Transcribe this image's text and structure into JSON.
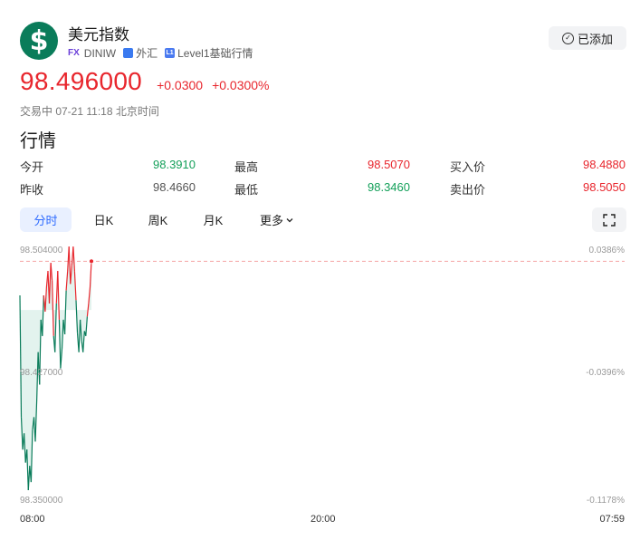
{
  "header": {
    "logo_symbol": "$",
    "title": "美元指数",
    "exchange_badge": "FX",
    "code": "DINIW",
    "category_icon": "chart-square-icon",
    "category": "外汇",
    "level_badge": "L1",
    "level_text": "Level1基础行情",
    "added_button": "已添加"
  },
  "price": {
    "last": "98.496000",
    "change": "+0.0300",
    "change_pct": "+0.0300%",
    "status": "交易中 07-21 11:18 北京时间"
  },
  "section_title": "行情",
  "quotes": [
    {
      "label": "今开",
      "value": "98.3910",
      "color": "green"
    },
    {
      "label": "最高",
      "value": "98.5070",
      "color": "red"
    },
    {
      "label": "买入价",
      "value": "98.4880",
      "color": "red"
    },
    {
      "label": "昨收",
      "value": "98.4660",
      "color": "gray"
    },
    {
      "label": "最低",
      "value": "98.3460",
      "color": "green"
    },
    {
      "label": "卖出价",
      "value": "98.5050",
      "color": "red"
    }
  ],
  "tabs": [
    "分时",
    "日K",
    "周K",
    "月K",
    "更多"
  ],
  "active_tab": "分时",
  "chart_axis": {
    "left_top": "98.504000",
    "left_mid": "98.427000",
    "left_bottom": "98.350000",
    "right_top": "0.0386%",
    "right_mid": "-0.0396%",
    "right_bottom": "-0.1178%",
    "time_start": "08:00",
    "time_mid": "20:00",
    "time_end": "07:59"
  },
  "chart_data": {
    "type": "line",
    "title": "",
    "xlabel": "",
    "ylabel": "",
    "x": [
      "08:00",
      "20:00",
      "07:59"
    ],
    "ylim": [
      98.35,
      98.504
    ],
    "prev_close": 98.466,
    "last_price": 98.496,
    "series": [
      {
        "values": [
          98.475,
          98.4,
          98.38,
          98.39,
          98.372,
          98.38,
          98.355,
          98.37,
          98.36,
          98.392,
          98.4,
          98.385,
          98.41,
          98.44,
          98.42,
          98.46,
          98.45,
          98.475,
          98.465,
          98.48,
          98.49,
          98.47,
          98.495,
          98.484,
          98.45,
          98.44,
          98.47,
          98.49,
          98.46,
          98.43,
          98.442,
          98.46,
          98.451,
          98.478,
          98.49,
          98.505,
          98.482,
          98.493,
          98.505,
          98.49,
          98.472,
          98.452,
          98.44,
          98.46,
          98.447,
          98.44,
          98.453,
          98.45,
          98.462,
          98.47,
          98.48,
          98.496
        ]
      }
    ],
    "colors": {
      "up": "#e8262d",
      "down": "#0a7c5a",
      "area": "#e3f3ee",
      "ref_line": "#f5a3a3"
    }
  }
}
